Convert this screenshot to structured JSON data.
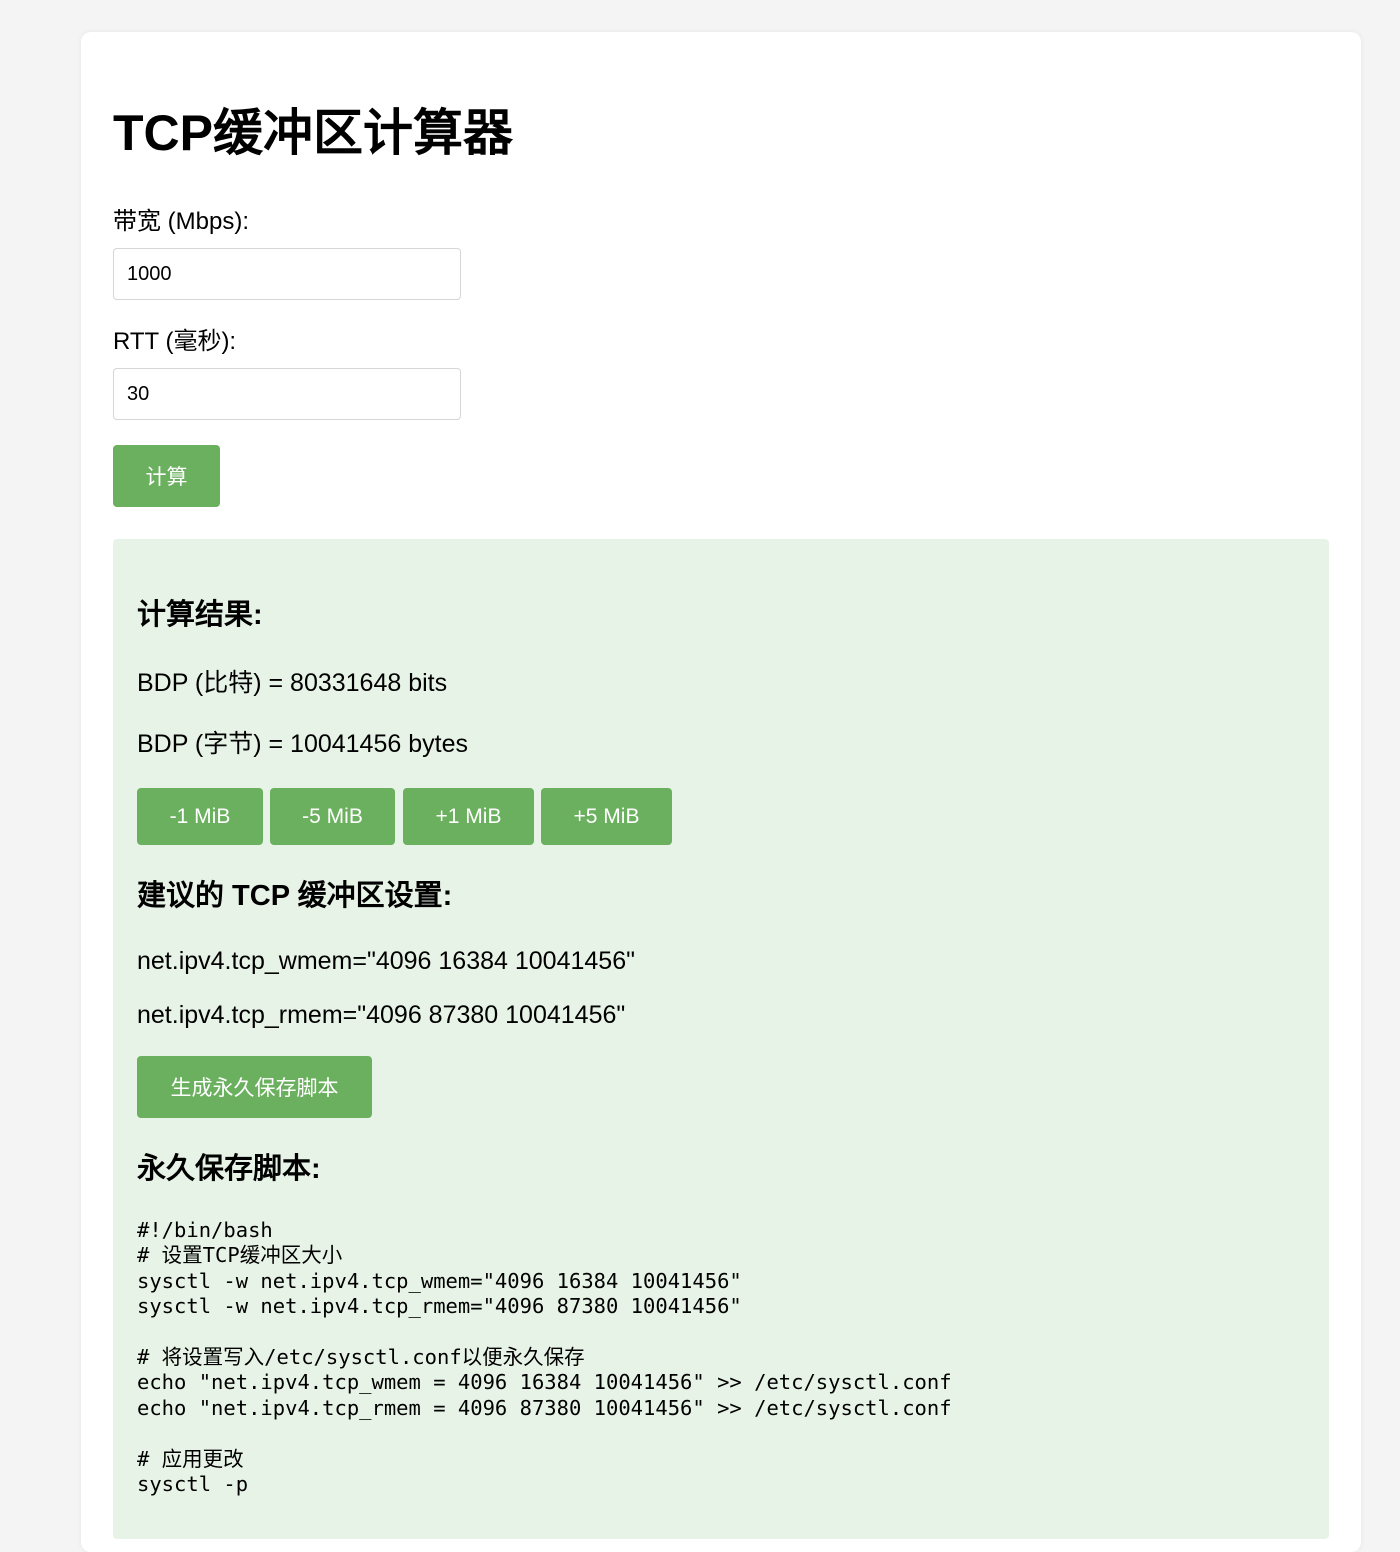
{
  "title": "TCP缓冲区计算器",
  "bandwidth": {
    "label": "带宽 (Mbps):",
    "value": "1000"
  },
  "rtt": {
    "label": "RTT (毫秒):",
    "value": "30"
  },
  "calculate_button": "计算",
  "results": {
    "heading": "计算结果:",
    "bdp_bits": "BDP (比特) = 80331648 bits",
    "bdp_bytes": "BDP (字节) = 10041456 bytes",
    "adjust_buttons": [
      "-1 MiB",
      "-5 MiB",
      "+1 MiB",
      "+5 MiB"
    ]
  },
  "suggested": {
    "heading": "建议的 TCP 缓冲区设置:",
    "wmem": "net.ipv4.tcp_wmem=\"4096 16384 10041456\"",
    "rmem": "net.ipv4.tcp_rmem=\"4096 87380 10041456\"",
    "generate_button": "生成永久保存脚本"
  },
  "script": {
    "heading": "永久保存脚本:",
    "content": "#!/bin/bash\n# 设置TCP缓冲区大小\nsysctl -w net.ipv4.tcp_wmem=\"4096 16384 10041456\"\nsysctl -w net.ipv4.tcp_rmem=\"4096 87380 10041456\"\n\n# 将设置写入/etc/sysctl.conf以便永久保存\necho \"net.ipv4.tcp_wmem = 4096 16384 10041456\" >> /etc/sysctl.conf\necho \"net.ipv4.tcp_rmem = 4096 87380 10041456\" >> /etc/sysctl.conf\n\n# 应用更改\nsysctl -p"
  },
  "colors": {
    "page_background": "#f4f4f4",
    "card_background": "#ffffff",
    "accent_green": "#6bb05f",
    "result_panel_background": "#e8f3e7"
  }
}
